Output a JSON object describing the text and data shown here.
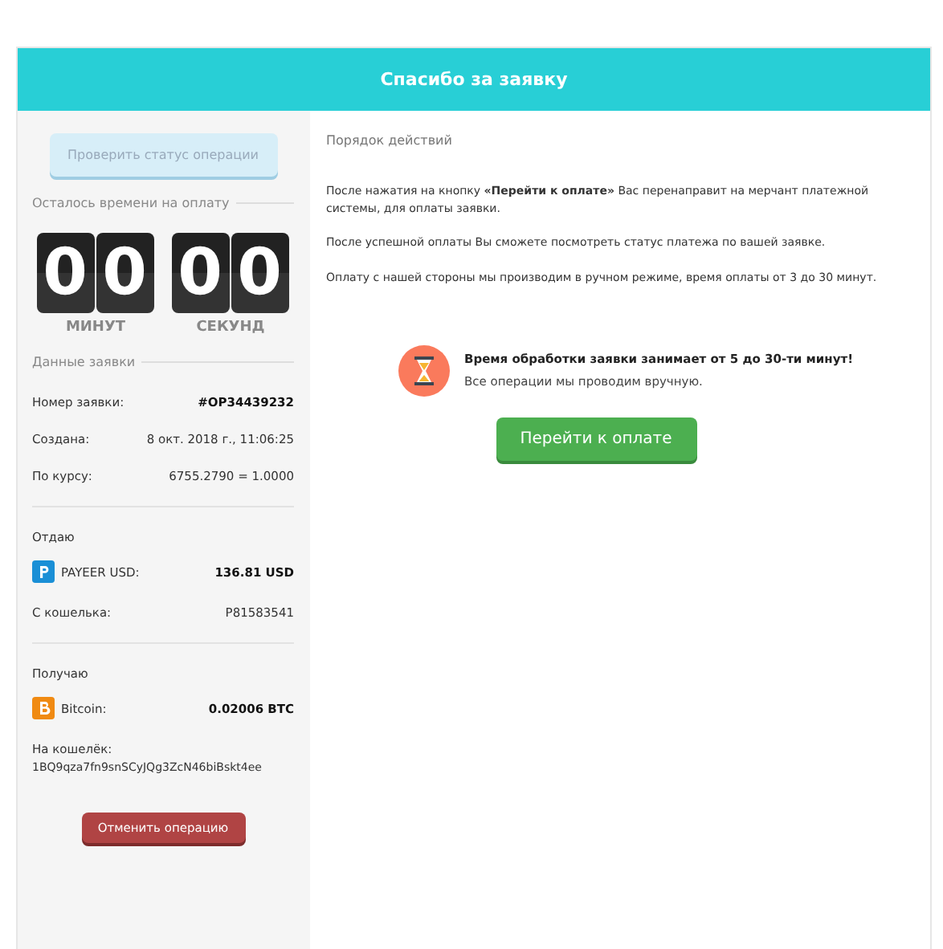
{
  "header": {
    "title": "Спасибо за заявку"
  },
  "sidebar": {
    "check_status_button": {
      "label": "Проверить статус операции",
      "disabled": true
    },
    "timer_heading": "Осталось времени на оплату",
    "timer": [
      {
        "digits": [
          "0",
          "0"
        ],
        "label": "МИНУТ"
      },
      {
        "digits": [
          "0",
          "0"
        ],
        "label": "СЕКУНД"
      }
    ],
    "details_heading": "Данные заявки",
    "details": [
      {
        "label": "Номер заявки:",
        "value": "#OP34439232",
        "bold": true
      },
      {
        "label": "Создана:",
        "value": "8 окт. 2018 г., 11:06:25",
        "bold": false
      },
      {
        "label": "По курсу:",
        "value": "6755.2790 = 1.0000",
        "bold": false
      }
    ],
    "give": {
      "heading": "Отдаю",
      "kind": "payeer",
      "currency": "PAYEER USD:",
      "amount": "136.81 USD",
      "wallet_label": "С кошелька:",
      "wallet": "P81583541"
    },
    "receive": {
      "heading": "Получаю",
      "kind": "bitcoin",
      "currency": "Bitcoin:",
      "amount": "0.02006 BTC",
      "wallet_label": "На кошелёк:",
      "wallet": "1BQ9qza7fn9snSCyJQg3ZcN46biBskt4ee"
    },
    "cancel_button": "Отменить операцию"
  },
  "main": {
    "heading": "Порядок действий",
    "paragraphs": [
      "После нажатия на кнопку **«Перейти к оплате»** Вас перенаправит на мерчант платежной системы, для оплаты заявки.",
      "После успешной оплаты Вы сможете посмотреть статус платежа по вашей заявке.",
      "Оплату с нашей стороны мы производим в ручном режиме, время оплаты от 3 до 30 минут."
    ],
    "notice": {
      "title": "Время обработки заявки занимает от 5 до 30-ти минут!",
      "text": "Все операции мы проводим вручную."
    },
    "pay_button": "Перейти к оплате"
  }
}
